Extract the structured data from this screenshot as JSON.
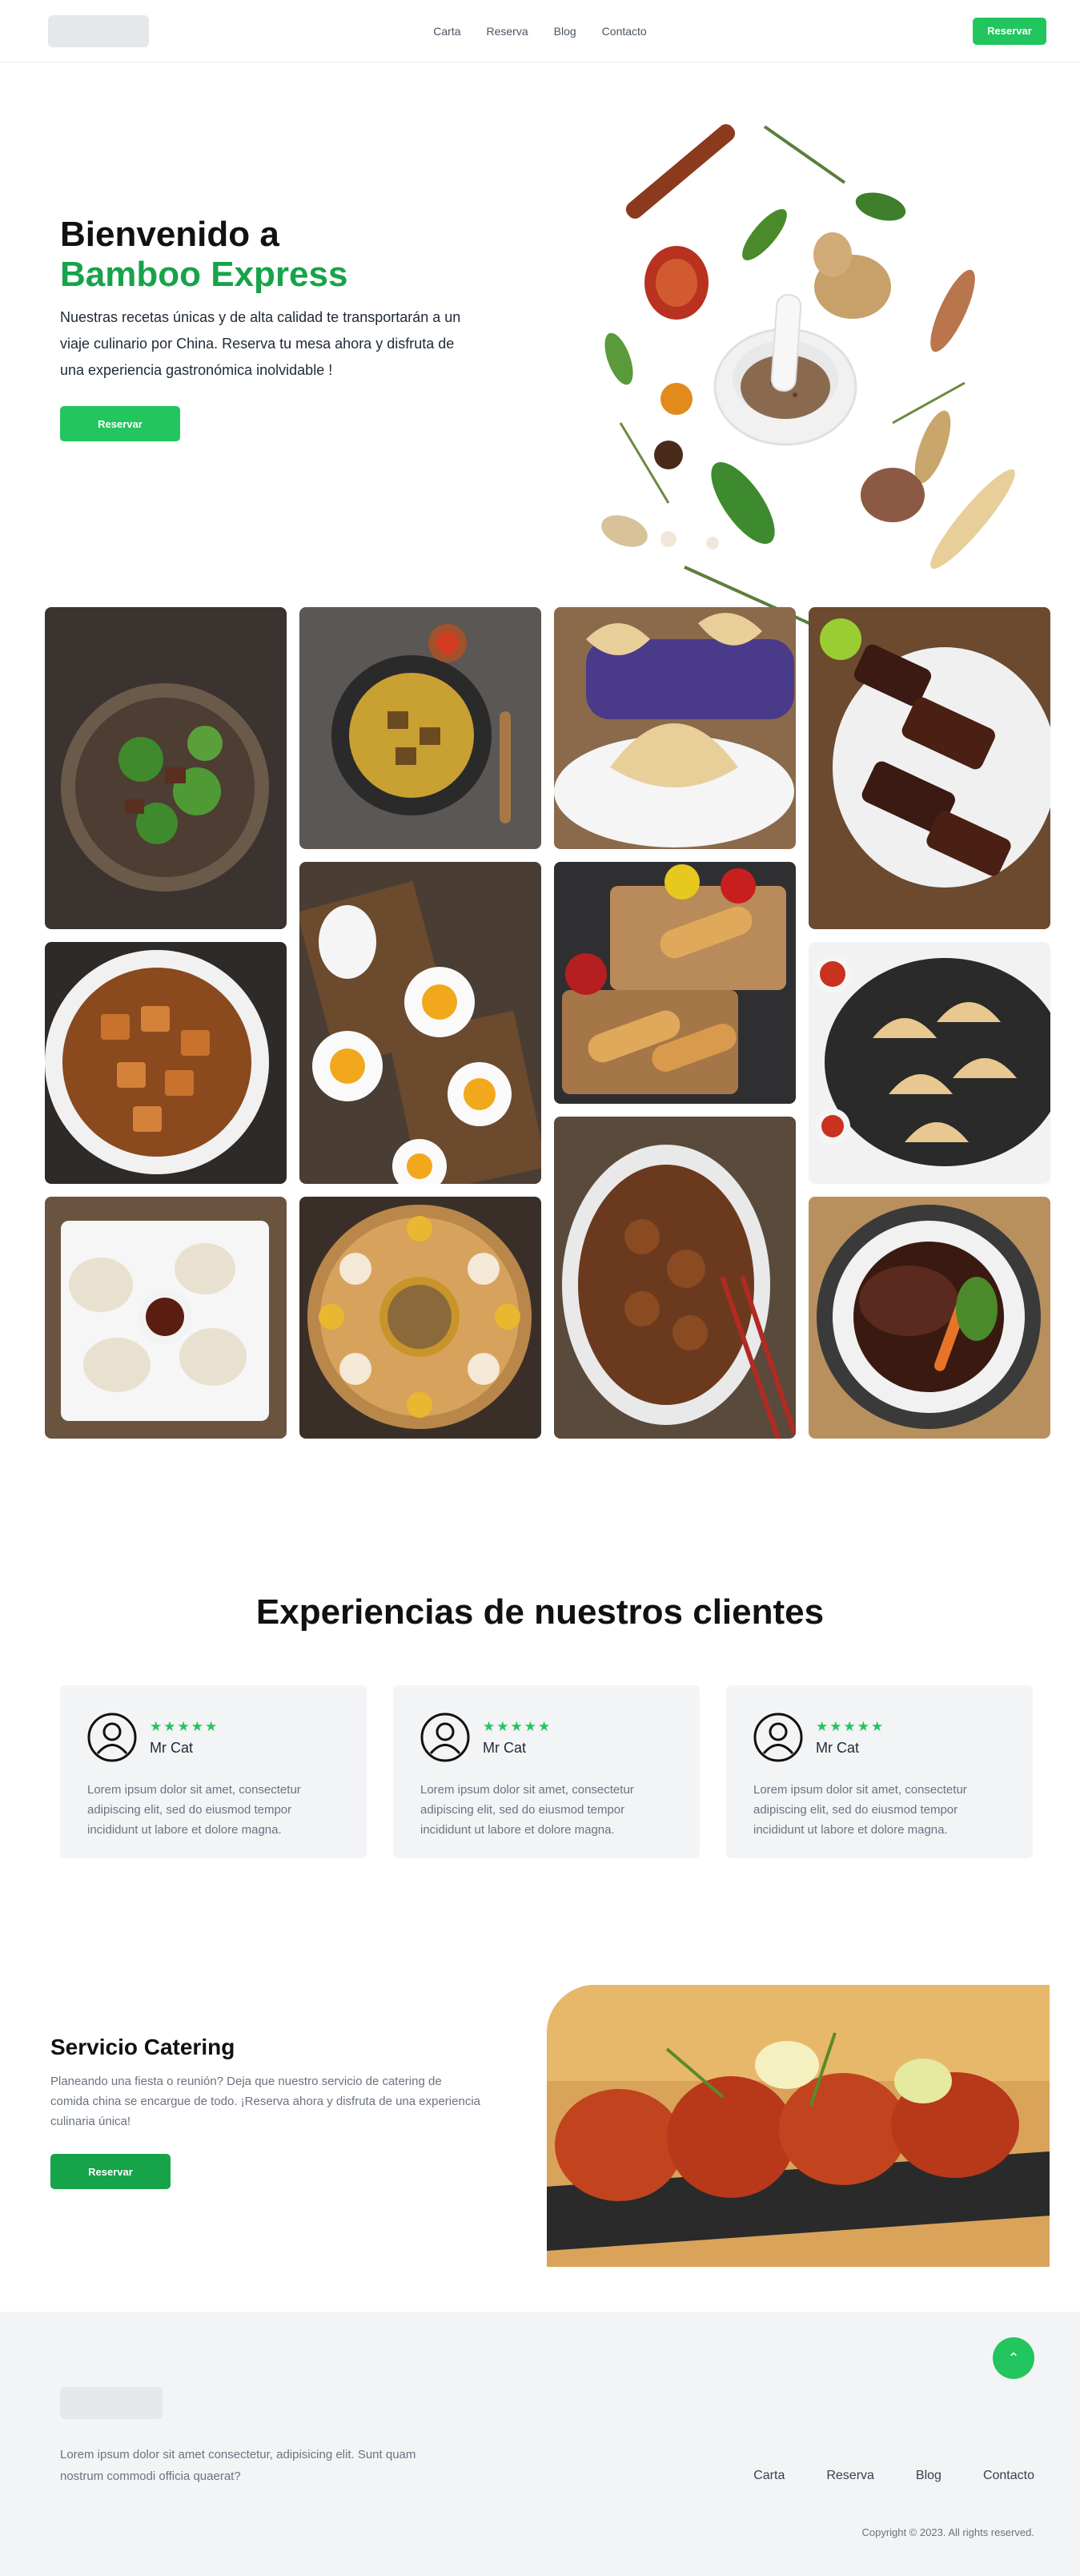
{
  "nav": {
    "links": [
      "Carta",
      "Reserva",
      "Blog",
      "Contacto"
    ],
    "cta_label": "Reservar"
  },
  "hero": {
    "title_line1": "Bienvenido a",
    "title_line2": "Bamboo Express",
    "description": "Nuestras recetas únicas y de alta calidad te transportarán a un viaje culinario por China. Reserva tu mesa ahora y disfruta de una experiencia gastronómica inolvidable !",
    "cta_label": "Reservar"
  },
  "testimonials": {
    "title": "Experiencias de nuestros clientes",
    "cards": [
      {
        "stars": "★★★★★",
        "name": "Mr Cat",
        "text": "Lorem ipsum dolor sit amet, consectetur adipiscing elit, sed do eiusmod tempor incididunt ut labore et dolore magna."
      },
      {
        "stars": "★★★★★",
        "name": "Mr Cat",
        "text": "Lorem ipsum dolor sit amet, consectetur adipiscing elit, sed do eiusmod tempor incididunt ut labore et dolore magna."
      },
      {
        "stars": "★★★★★",
        "name": "Mr Cat",
        "text": "Lorem ipsum dolor sit amet, consectetur adipiscing elit, sed do eiusmod tempor incididunt ut labore et dolore magna."
      }
    ]
  },
  "catering": {
    "title": "Servicio Catering",
    "description": "Planeando una fiesta o reunión? Deja que nuestro servicio de catering de comida china se encargue de todo. ¡Reserva ahora y disfruta de una experiencia culinaria única!",
    "cta_label": "Reservar"
  },
  "footer": {
    "description": "Lorem ipsum dolor sit amet consectetur, adipisicing elit. Sunt quam nostrum commodi officia quaerat?",
    "links": [
      "Carta",
      "Reserva",
      "Blog",
      "Contacto"
    ],
    "copyright": "Copyright © 2023. All rights reserved."
  },
  "colors": {
    "brand_green": "#22c55e",
    "accent_green": "#16a34a",
    "star": "#22c55e"
  }
}
